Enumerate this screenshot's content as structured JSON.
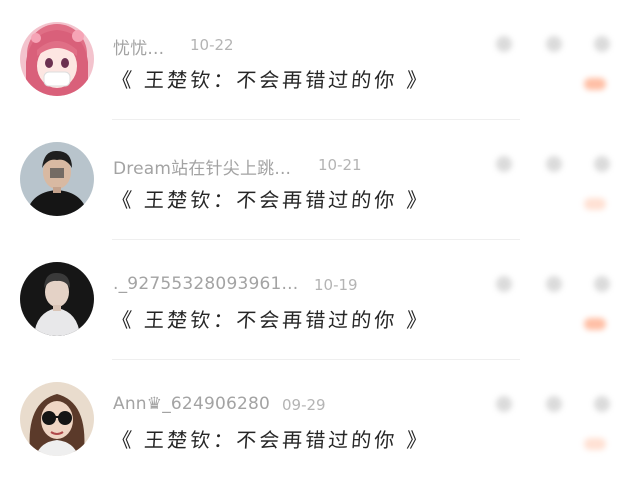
{
  "comments": [
    {
      "username": "忧忧...",
      "date": "10-22",
      "text": "《 王楚钦：不会再错过的你 》",
      "avatar_icon": "anime-girl-pink-hair-avatar",
      "avatar_color": "#e88a9a"
    },
    {
      "username": "Dream站在针尖上跳...",
      "date": "10-21",
      "text": "《 王楚钦：不会再错过的你 》",
      "avatar_icon": "man-dark-jacket-avatar",
      "avatar_color": "#9aa8b0"
    },
    {
      "username": "._92755328093961...",
      "date": "10-19",
      "text": "《 王楚钦：不会再错过的你 》",
      "avatar_icon": "man-dark-background-avatar",
      "avatar_color": "#1e1e1e"
    },
    {
      "username": "Ann♛_624906280",
      "date": "09-29",
      "text": "《 王楚钦：不会再错过的你 》",
      "avatar_icon": "girl-sunglasses-avatar",
      "avatar_color": "#c9a98a"
    }
  ]
}
